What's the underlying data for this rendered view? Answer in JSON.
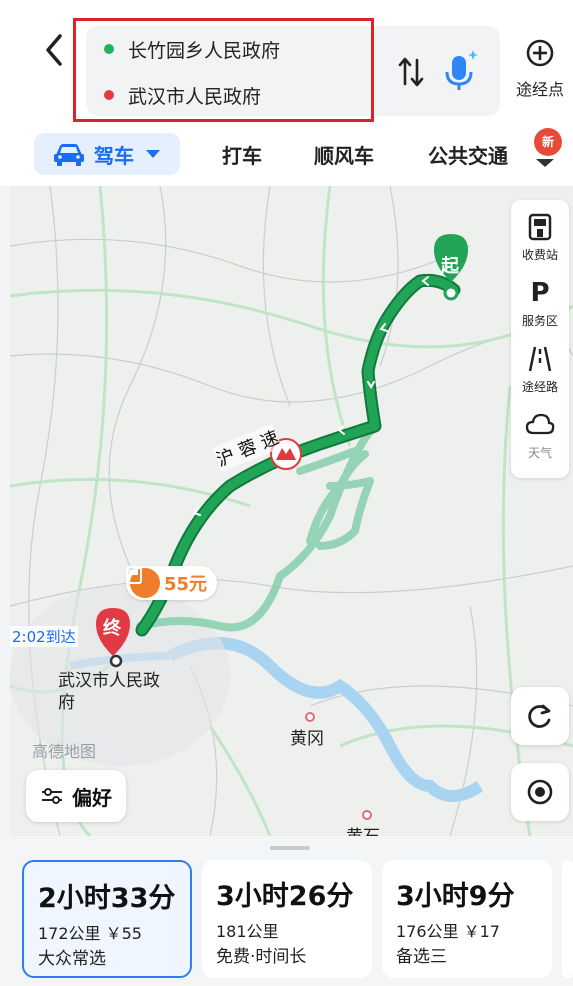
{
  "header": {
    "start": "长竹园乡人民政府",
    "end": "武汉市人民政府",
    "waypoint_label": "途经点"
  },
  "tabs": {
    "drive": "驾车",
    "taxi": "打车",
    "carpool": "顺风车",
    "transit": "公共交通",
    "new_badge": "新"
  },
  "map": {
    "start_marker": "起",
    "end_marker": "终",
    "highway_name": "沪 蓉 速",
    "toll_fee": "55元",
    "arrival_time": "2:02到达",
    "dest_label_line1": "武汉市人民政",
    "dest_label_line2": "府",
    "city_huanggang": "黄冈",
    "city_huangshi": "黄石",
    "watermark": "高德地图"
  },
  "side_panel": {
    "toll": "收费站",
    "service": "服务区",
    "route_road": "途经路",
    "weather": "天气"
  },
  "preference": "偏好",
  "routes": [
    {
      "time": "2小时33分",
      "info": "172公里 ￥55",
      "tag": "大众常选"
    },
    {
      "time": "3小时26分",
      "info": "181公里",
      "tag": "免费·时间长"
    },
    {
      "time": "3小时9分",
      "info": "176公里 ￥17",
      "tag": "备选三"
    }
  ],
  "colors": {
    "route_selected": "#1fa85a",
    "route_alt": "#7fcba6",
    "accent": "#1a6cf2",
    "end_marker": "#e23a44"
  }
}
